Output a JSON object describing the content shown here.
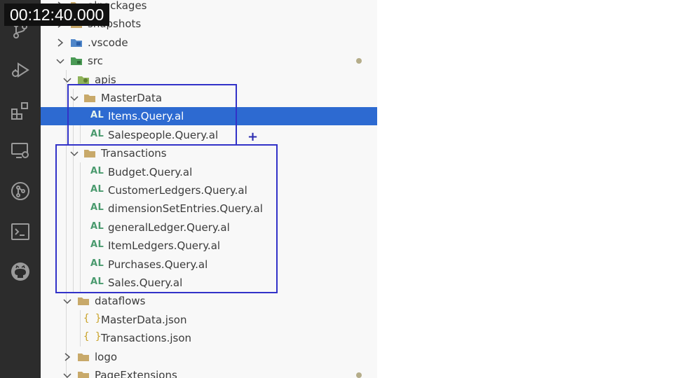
{
  "overlay": {
    "timestamp": "00:12:40.000"
  },
  "activity_bar": {
    "icons": [
      "source-control-icon",
      "run-debug-icon",
      "extensions-icon",
      "remote-explorer-icon",
      "git-graph-icon",
      "terminal-icon",
      "github-icon"
    ]
  },
  "explorer": {
    "items": [
      {
        "label": "alpackages",
        "kind": "folder",
        "expanded": false
      },
      {
        "label": "snapshots",
        "kind": "folder",
        "expanded": false
      },
      {
        "label": ".vscode",
        "kind": "vscode-folder",
        "expanded": false
      },
      {
        "label": "src",
        "kind": "src-folder",
        "expanded": true,
        "modified": true
      },
      {
        "label": "apis",
        "kind": "api-folder",
        "expanded": true
      },
      {
        "label": "MasterData",
        "kind": "folder",
        "expanded": true
      },
      {
        "label": "Items.Query.al",
        "kind": "al-file",
        "badge": "AL",
        "selected": true
      },
      {
        "label": "Salespeople.Query.al",
        "kind": "al-file",
        "badge": "AL"
      },
      {
        "label": "Transactions",
        "kind": "folder",
        "expanded": true
      },
      {
        "label": "Budget.Query.al",
        "kind": "al-file",
        "badge": "AL"
      },
      {
        "label": "CustomerLedgers.Query.al",
        "kind": "al-file",
        "badge": "AL"
      },
      {
        "label": "dimensionSetEntries.Query.al",
        "kind": "al-file",
        "badge": "AL"
      },
      {
        "label": "generalLedger.Query.al",
        "kind": "al-file",
        "badge": "AL"
      },
      {
        "label": "ItemLedgers.Query.al",
        "kind": "al-file",
        "badge": "AL"
      },
      {
        "label": "Purchases.Query.al",
        "kind": "al-file",
        "badge": "AL"
      },
      {
        "label": "Sales.Query.al",
        "kind": "al-file",
        "badge": "AL"
      },
      {
        "label": "dataflows",
        "kind": "folder",
        "expanded": true
      },
      {
        "label": "MasterData.json",
        "kind": "json-file",
        "badge": "{ }"
      },
      {
        "label": "Transactions.json",
        "kind": "json-file",
        "badge": "{ }"
      },
      {
        "label": "logo",
        "kind": "folder",
        "expanded": false
      },
      {
        "label": "PageExtensions",
        "kind": "folder",
        "expanded": true,
        "modified": true
      }
    ]
  },
  "annotations": {
    "plus_symbol": "+"
  },
  "colors": {
    "activity_bar": "#2c2c2c",
    "selection": "#2d6ad1",
    "al_badge": "#4a9a6e",
    "folder": "#c8a96a",
    "highlight_box": "#3232c8"
  }
}
